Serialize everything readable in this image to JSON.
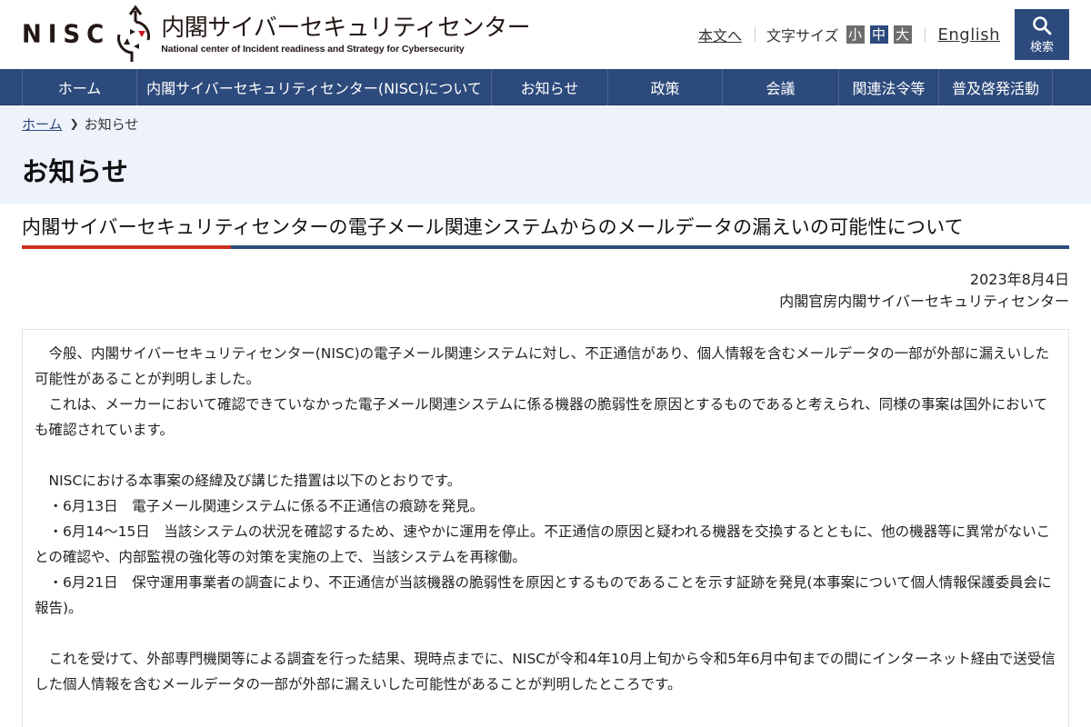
{
  "header": {
    "logo_abbr": "NISC",
    "logo_title_jp": "内閣サイバーセキュリティセンター",
    "logo_title_en": "National center of Incident readiness and Strategy for Cybersecurity",
    "skip_link": "本文へ",
    "font_size_label": "文字サイズ",
    "font_size_options": [
      "小",
      "中",
      "大"
    ],
    "font_size_selected": "中",
    "english_link": "English",
    "search_label": "検索",
    "icons": {
      "search": "search-icon",
      "logo": "nisc-logo-mark"
    }
  },
  "nav": {
    "items": [
      {
        "label": "ホーム"
      },
      {
        "label": "内閣サイバーセキュリティセンター(NISC)について"
      },
      {
        "label": "お知らせ"
      },
      {
        "label": "政策"
      },
      {
        "label": "会議"
      },
      {
        "label": "関連法令等"
      },
      {
        "label": "普及啓発活動"
      }
    ]
  },
  "breadcrumb": {
    "home": "ホーム",
    "separator_icon": "chevron-right-icon",
    "current": "お知らせ"
  },
  "page": {
    "title": "お知らせ"
  },
  "article": {
    "title": "内閣サイバーセキュリティセンターの電子メール関連システムからのメールデータの漏えいの可能性について",
    "date": "2023年8月4日",
    "publisher": "内閣官房内閣サイバーセキュリティセンター",
    "paragraphs": [
      "　今般、内閣サイバーセキュリティセンター(NISC)の電子メール関連システムに対し、不正通信があり、個人情報を含むメールデータの一部が外部に漏えいした可能性があることが判明しました。",
      "　これは、メーカーにおいて確認できていなかった電子メール関連システムに係る機器の脆弱性を原因とするものであると考えられ、同様の事案は国外においても確認されています。",
      "",
      "　NISCにおける本事案の経緯及び講じた措置は以下のとおりです。",
      "　・6月13日　電子メール関連システムに係る不正通信の痕跡を発見。",
      "　・6月14～15日　当該システムの状況を確認するため、速やかに運用を停止。不正通信の原因と疑われる機器を交換するとともに、他の機器等に異常がないことの確認や、内部監視の強化等の対策を実施の上で、当該システムを再稼働。",
      "　・6月21日　保守運用事業者の調査により、不正通信が当該機器の脆弱性を原因とするものであることを示す証跡を発見(本事案について個人情報保護委員会に報告)。",
      "",
      "　これを受けて、外部専門機関等による調査を行った結果、現時点までに、NISCが令和4年10月上旬から令和5年6月中旬までの間にインターネット経由で送受信した個人情報を含むメールデータの一部が外部に漏えいした可能性があることが判明したところです。"
    ]
  },
  "colors": {
    "brand_navy": "#2d4a7c",
    "accent_red": "#cf2e1f",
    "band_bg": "#eef2fb",
    "logo_red": "#c8161d"
  }
}
